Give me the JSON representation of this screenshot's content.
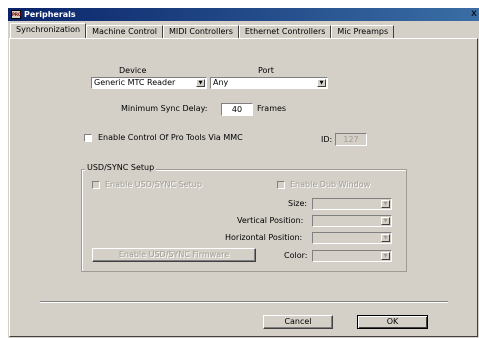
{
  "window": {
    "title": "Peripherals",
    "app_icon": "pro-tools-icon",
    "close_glyph": "x"
  },
  "tabs": [
    {
      "label": "Synchronization",
      "active": true
    },
    {
      "label": "Machine Control",
      "active": false
    },
    {
      "label": "MIDI Controllers",
      "active": false
    },
    {
      "label": "Ethernet Controllers",
      "active": false
    },
    {
      "label": "Mic Preamps",
      "active": false
    }
  ],
  "sync": {
    "device_label": "Device",
    "port_label": "Port",
    "device_value": "Generic MTC Reader",
    "port_value": "Any",
    "min_delay_label": "Minimum Sync Delay:",
    "min_delay_value": "40",
    "frames_label": "Frames",
    "mmc_label": "Enable Control Of Pro Tools Via MMC",
    "mmc_checked": false,
    "id_label": "ID:",
    "id_value": "127"
  },
  "usd": {
    "group_title": "USD/SYNC Setup",
    "enable_label": "Enable USD/SYNC Setup",
    "enable_checked": false,
    "dub_label": "Enable Dub Window",
    "dub_checked": false,
    "size_label": "Size:",
    "vpos_label": "Vertical Position:",
    "hpos_label": "Horizontal Position:",
    "color_label": "Color:",
    "size_value": "",
    "vpos_value": "",
    "hpos_value": "",
    "color_value": "",
    "firmware_button": "Enable USD/SYNC Firmware"
  },
  "footer": {
    "cancel_label": "Cancel",
    "ok_label": "OK"
  },
  "arrow_glyph": "▼"
}
